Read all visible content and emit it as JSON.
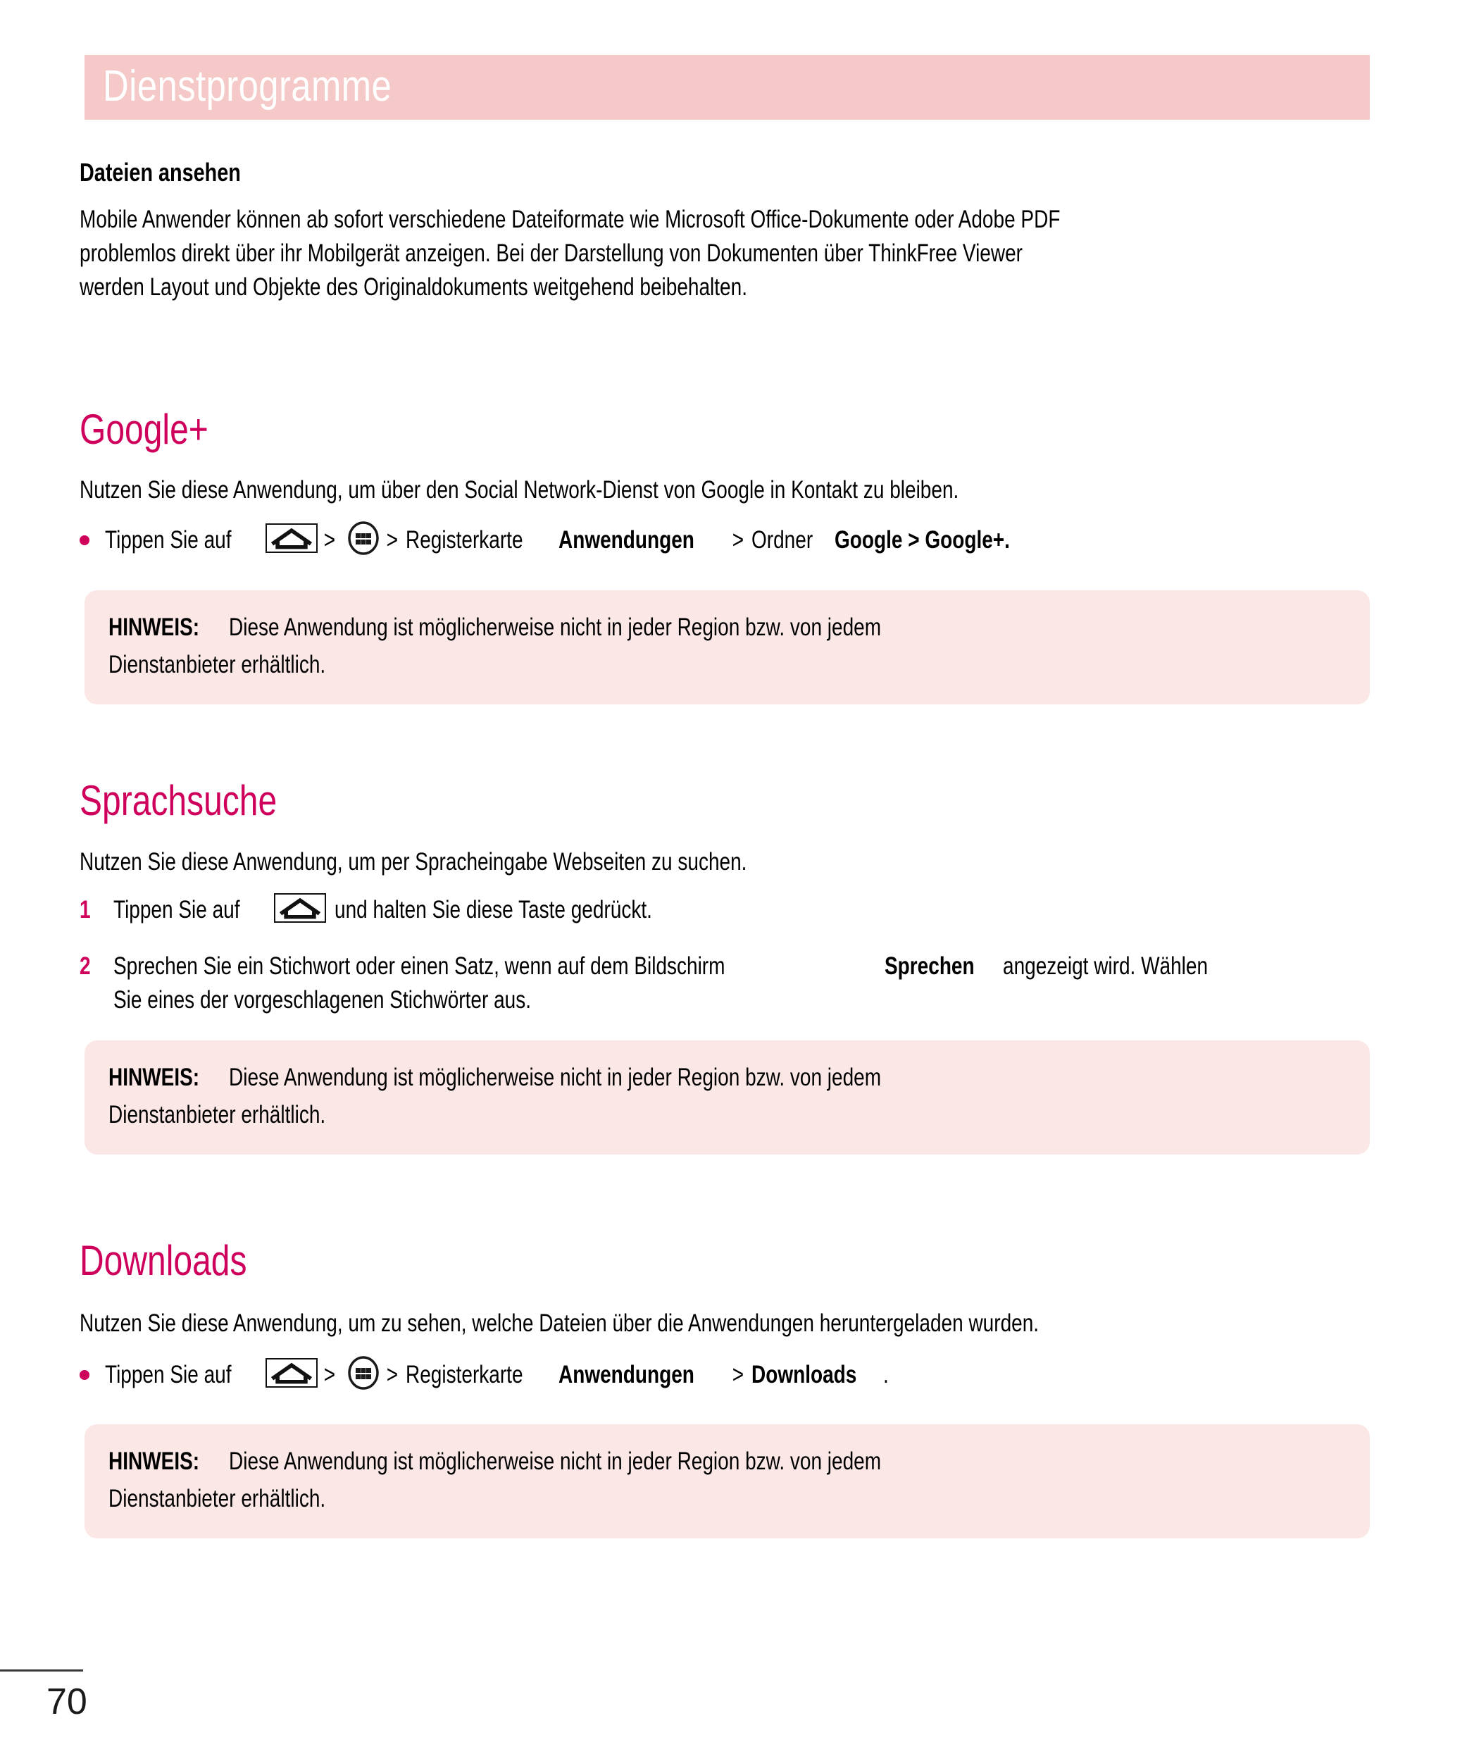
{
  "page": {
    "number": "70",
    "accent_color": "#cf005c",
    "header_band_color": "#f4c9c7",
    "note_box_color": "#fbe7e5",
    "header_title": "Dienstprogramme"
  },
  "files_section": {
    "subhead": "Dateien ansehen",
    "paragraph_lines": [
      "Mobile Anwender können ab sofort verschiedene Dateiformate wie Microsoft Office-Dokumente oder Adobe PDF",
      "problemlos direkt über ihr Mobilgerät anzeigen. Bei der Darstellung von Dokumenten über ThinkFree Viewer",
      "werden Layout und Objekte des Originaldokuments weitgehend beibehalten."
    ]
  },
  "googleplus_section": {
    "title": "Google+",
    "intro": "Nutzen Sie diese Anwendung, um über den Social Network-Dienst von Google in Kontakt zu bleiben.",
    "bullet": {
      "lead": "Tippen Sie auf",
      "home_icon": "home-icon",
      "chevron_1": ">",
      "apps_icon": "apps-grid-icon",
      "chevron_2": ">",
      "after_apps": "Registerkarte",
      "bold_1": "Anwendungen",
      "chevron_3": ">",
      "mid": "Ordner",
      "bold_2": "Google > Google+."
    },
    "note": {
      "label": "HINWEIS:",
      "line_1": "Diese Anwendung ist möglicherweise nicht in jeder Region bzw. von jedem",
      "line_2": "Dienstanbieter erhältlich."
    }
  },
  "voicesearch_section": {
    "title": "Sprachsuche",
    "intro": "Nutzen Sie diese Anwendung, um per Spracheingabe Webseiten zu suchen.",
    "steps": [
      {
        "number": "1",
        "lead": "Tippen Sie auf",
        "home_icon": "home-icon",
        "tail": "und halten Sie diese Taste gedrückt."
      },
      {
        "number": "2",
        "line_1_a": "Sprechen Sie ein Stichwort oder einen Satz, wenn auf dem Bildschirm",
        "line_1_bold": "Sprechen",
        "line_1_b": "angezeigt wird. Wählen",
        "line_2": "Sie eines der vorgeschlagenen Stichwörter aus."
      }
    ],
    "note": {
      "label": "HINWEIS:",
      "line_1": "Diese Anwendung ist möglicherweise nicht in jeder Region bzw. von jedem",
      "line_2": "Dienstanbieter erhältlich."
    }
  },
  "downloads_section": {
    "title": "Downloads",
    "intro": "Nutzen Sie diese Anwendung, um zu sehen, welche Dateien über die Anwendungen heruntergeladen wurden.",
    "bullet": {
      "lead": "Tippen Sie auf",
      "home_icon": "home-icon",
      "chevron_1": ">",
      "apps_icon": "apps-grid-icon",
      "chevron_2": ">",
      "after_apps": "Registerkarte",
      "bold_1": "Anwendungen",
      "chevron_3": ">",
      "bold_2": "Downloads",
      "period": "."
    },
    "note": {
      "label": "HINWEIS:",
      "line_1": "Diese Anwendung ist möglicherweise nicht in jeder Region bzw. von jedem",
      "line_2": "Dienstanbieter erhältlich."
    }
  }
}
